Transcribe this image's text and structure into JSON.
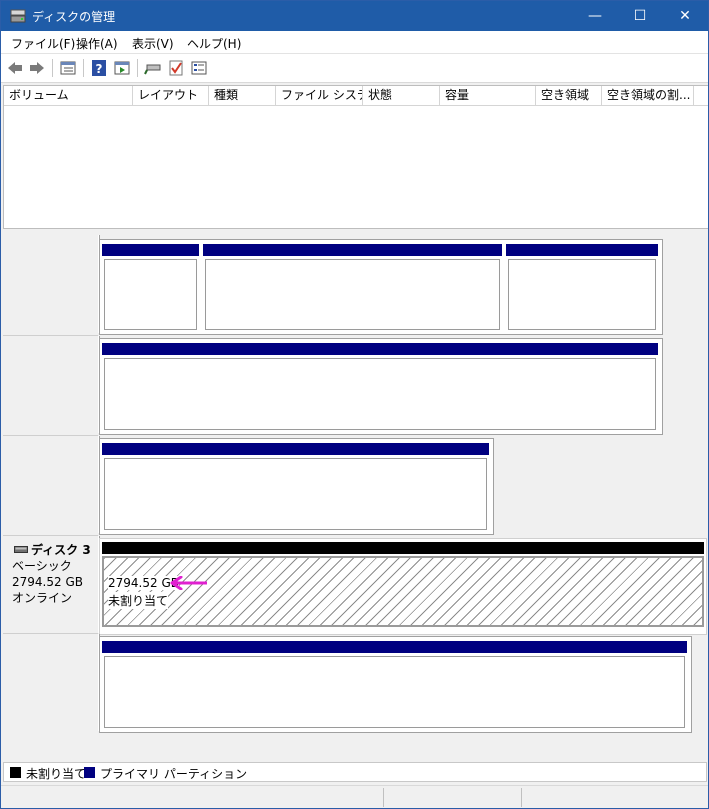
{
  "window": {
    "title": "ディスクの管理",
    "minimize_glyph": "—",
    "maximize_glyph": "☐",
    "close_glyph": "✕"
  },
  "menu": [
    {
      "label": "ファイル(F)"
    },
    {
      "label": "操作(A)"
    },
    {
      "label": "表示(V)"
    },
    {
      "label": "ヘルプ(H)"
    }
  ],
  "toolbar": [
    "back-arrow-icon",
    "forward-arrow-icon",
    "list-view-icon",
    "help-icon",
    "action-pane-icon",
    "connect-drive-icon",
    "check-icon",
    "properties-icon"
  ],
  "volume_list": {
    "columns": [
      "ボリューム",
      "レイアウト",
      "種類",
      "ファイル システム",
      "状態",
      "容量",
      "空き領域",
      "空き領域の割..."
    ]
  },
  "disk3": {
    "name": "ディスク 3",
    "type": "ベーシック",
    "size": "2794.52 GB",
    "status": "オンライン",
    "partition_size": "2794.52 GB",
    "partition_label": "未割り当て"
  },
  "legend": {
    "unallocated": "未割り当て",
    "primary": "プライマリ パーティション",
    "unallocated_color": "#000000",
    "primary_color": "#000080"
  },
  "colors": {
    "title_bar": "#1f5ca8",
    "primary_header": "#000080",
    "arrow": "#e020d0"
  }
}
